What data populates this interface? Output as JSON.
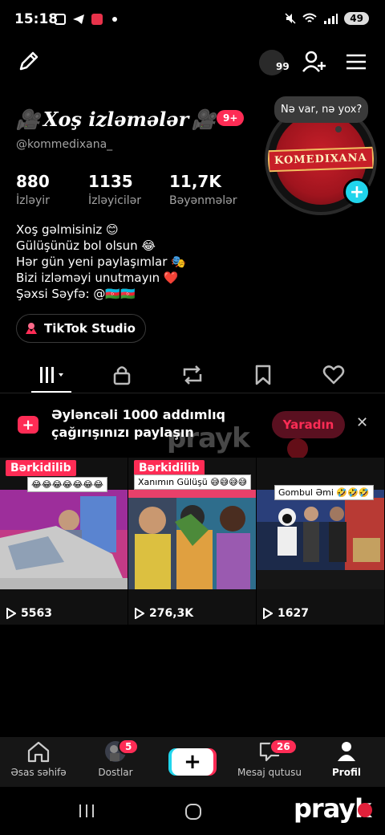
{
  "status_bar": {
    "time": "15:18",
    "battery": "49"
  },
  "header": {
    "follow_requests_count": "99"
  },
  "profile": {
    "display_name": "Xoş izləmələr",
    "notifications_badge": "9+",
    "username": "@kommedixana_",
    "note_bubble": "Nə var, nə yox?",
    "avatar_text": "KOMEDIXANA",
    "stats": [
      {
        "value": "880",
        "label": "İzləyir"
      },
      {
        "value": "1135",
        "label": "İzləyicilər"
      },
      {
        "value": "11,7K",
        "label": "Bəyənmələr"
      }
    ],
    "bio_lines": [
      "Xoş gəlmisiniz 😊",
      "Gülüşünüz bol olsun 😂",
      "Hər gün yeni paylaşımlar 🎭",
      "Bizi izləməyi unutmayın ❤️",
      "Şəxsi Səyfə: @🇦🇿🇦🇿"
    ],
    "studio_button": "TikTok Studio"
  },
  "tabs": [
    "videos",
    "private",
    "reposts",
    "favorites",
    "liked"
  ],
  "challenge_banner": {
    "line1": "Əyləncəli 1000 addımlıq",
    "line2": "çağırışınızı paylaşın",
    "button": "Yaradın"
  },
  "videos": [
    {
      "pinned_label": "Bərkidilib",
      "caption": "😂😂😂😂😂😂😂",
      "views": "5563"
    },
    {
      "pinned_label": "Bərkidilib",
      "caption": "Xanımın Gülüşü 😅😅😅😅",
      "views": "276,3K"
    },
    {
      "pinned_label": "",
      "caption": "Gombul Əmi 🤣🤣🤣",
      "views": "1627"
    }
  ],
  "bottom_nav": {
    "home": "Əsas səhifə",
    "friends": "Dostlar",
    "friends_badge": "5",
    "inbox": "Mesaj qutusu",
    "inbox_badge": "26",
    "profile": "Profil"
  },
  "watermark": "prayk"
}
